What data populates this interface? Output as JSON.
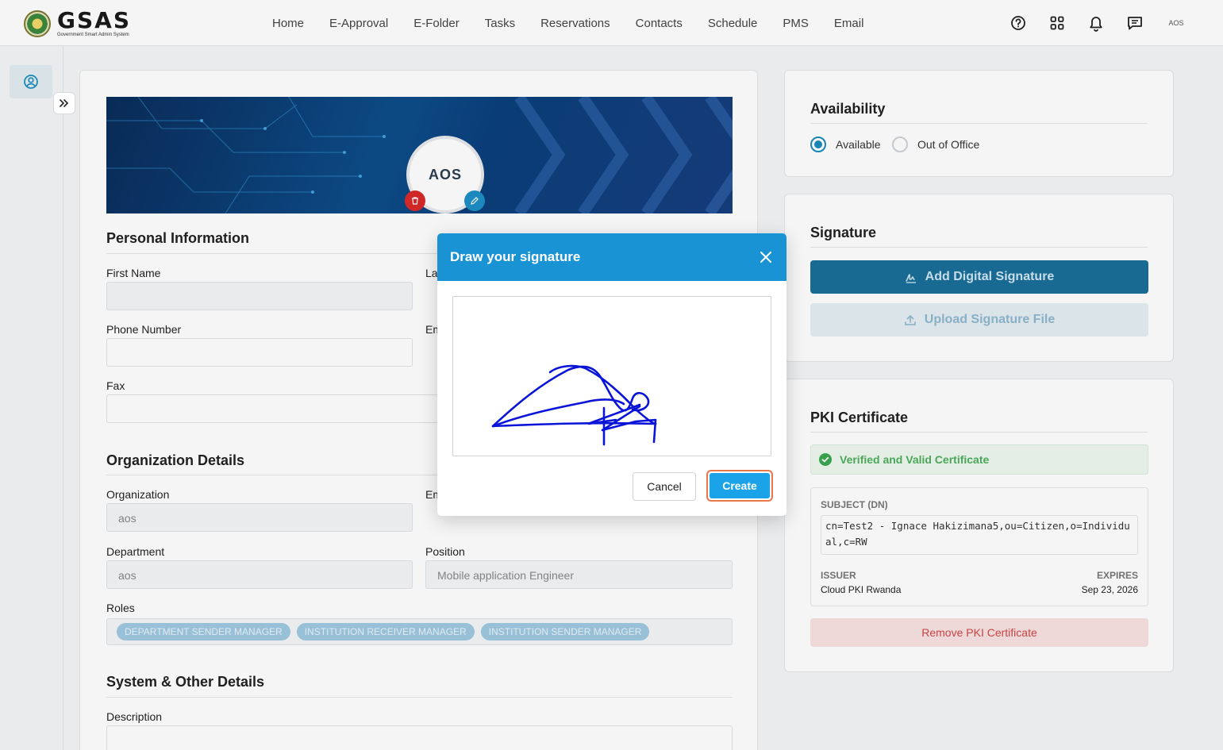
{
  "header": {
    "logo_text": "GSAS",
    "logo_subtitle": "Government Smart Admin System",
    "nav": [
      "Home",
      "E-Approval",
      "E-Folder",
      "Tasks",
      "Reservations",
      "Contacts",
      "Schedule",
      "PMS",
      "Email"
    ],
    "avatar_text": "AOS"
  },
  "profile": {
    "logo_text": "AOS"
  },
  "personal": {
    "title": "Personal Information",
    "first_name_label": "First Name",
    "first_name_value": "",
    "last_name_label": "La",
    "phone_label": "Phone Number",
    "email_label": "Em",
    "fax_label": "Fax"
  },
  "organization": {
    "title": "Organization Details",
    "org_label": "Organization",
    "org_value": "aos",
    "em_label": "Em",
    "dept_label": "Department",
    "dept_value": "aos",
    "position_label": "Position",
    "position_value": "Mobile application Engineer",
    "roles_label": "Roles",
    "roles": [
      "DEPARTMENT SENDER MANAGER",
      "INSTITUTION RECEIVER MANAGER",
      "INSTITUTION SENDER MANAGER"
    ]
  },
  "system": {
    "title": "System & Other Details",
    "description_label": "Description"
  },
  "availability": {
    "title": "Availability",
    "options": [
      "Available",
      "Out of Office"
    ],
    "selected": "Available"
  },
  "signature": {
    "title": "Signature",
    "add_label": "Add Digital Signature",
    "upload_label": "Upload Signature File"
  },
  "pki": {
    "title": "PKI Certificate",
    "status": "Verified and Valid Certificate",
    "subject_label": "SUBJECT (DN)",
    "subject_value": "cn=Test2 - Ignace Hakizimana5,ou=Citizen,o=Individual,c=RW",
    "issuer_label": "ISSUER",
    "issuer_value": "Cloud PKI Rwanda",
    "expires_label": "EXPIRES",
    "expires_value": "Sep 23, 2026",
    "remove_label": "Remove PKI Certificate"
  },
  "modal": {
    "title": "Draw your signature",
    "cancel_label": "Cancel",
    "create_label": "Create"
  },
  "colors": {
    "primary": "#1a93d4",
    "signature_stroke": "#0a14d8",
    "danger": "#d92a2a",
    "success": "#4cae5c"
  }
}
